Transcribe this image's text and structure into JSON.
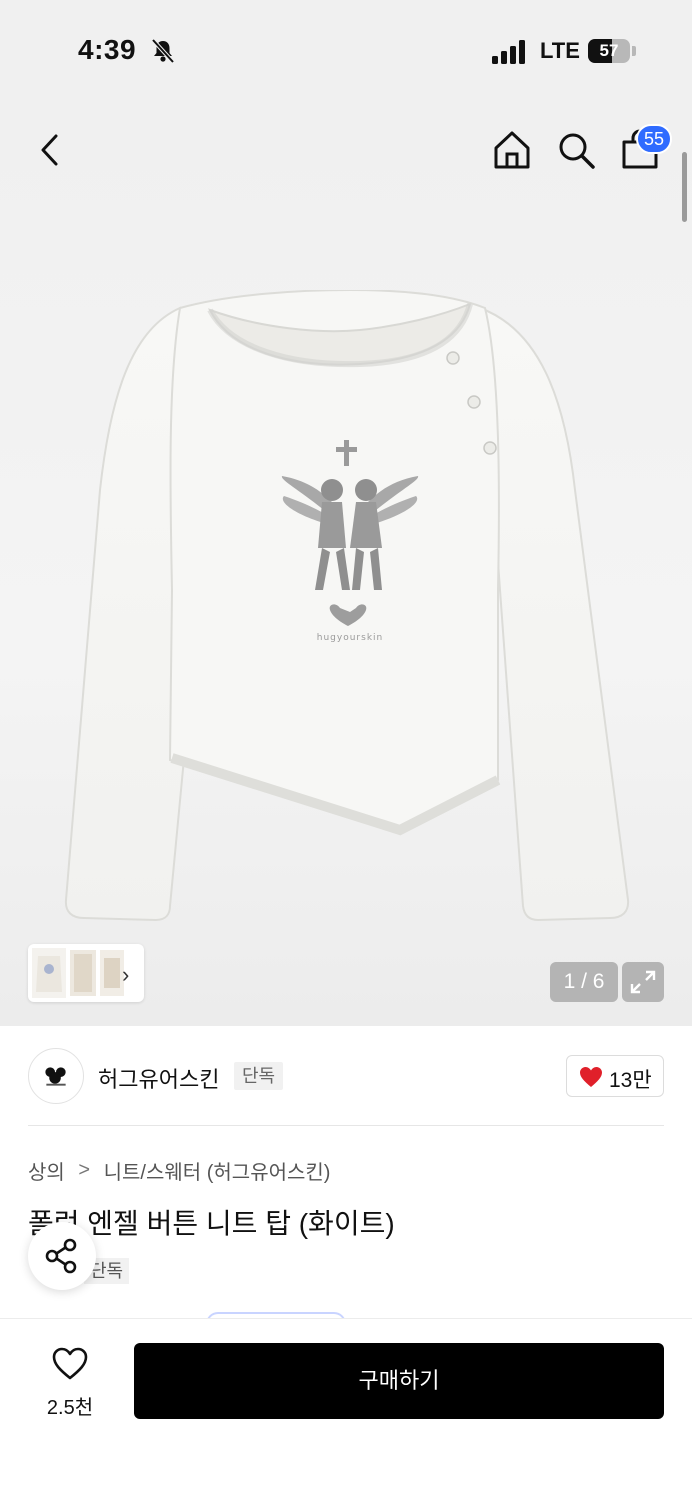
{
  "status_bar": {
    "time": "4:39",
    "network": "LTE",
    "battery": "57",
    "battery_level_percent": 57,
    "icons": [
      "bell-slash-icon",
      "signal-icon",
      "battery-icon"
    ]
  },
  "header": {
    "cart_badge": "55",
    "icons": [
      "back-chevron-icon",
      "home-icon",
      "search-icon",
      "cart-bag-icon"
    ]
  },
  "gallery": {
    "counter": "1 / 6",
    "thumbnail_chevron": "›",
    "icons": [
      "expand-icon"
    ]
  },
  "brand": {
    "name": "허그유어스킨",
    "tag": "단독",
    "like_count": "13만",
    "colors": {
      "heart": "#e0202a"
    }
  },
  "product": {
    "breadcrumb": [
      "상의",
      "니트/스웨터 (허그유어스킨)"
    ],
    "breadcrumb_separator": ">",
    "title": "폴런 엔젤 버튼 니트 탑 (화이트)",
    "tag": "단독"
  },
  "bottom_bar": {
    "wish_count": "2.5천",
    "buy_label": "구매하기",
    "colors": {
      "buy_button": "#000000",
      "badge": "#2f6bff"
    }
  }
}
